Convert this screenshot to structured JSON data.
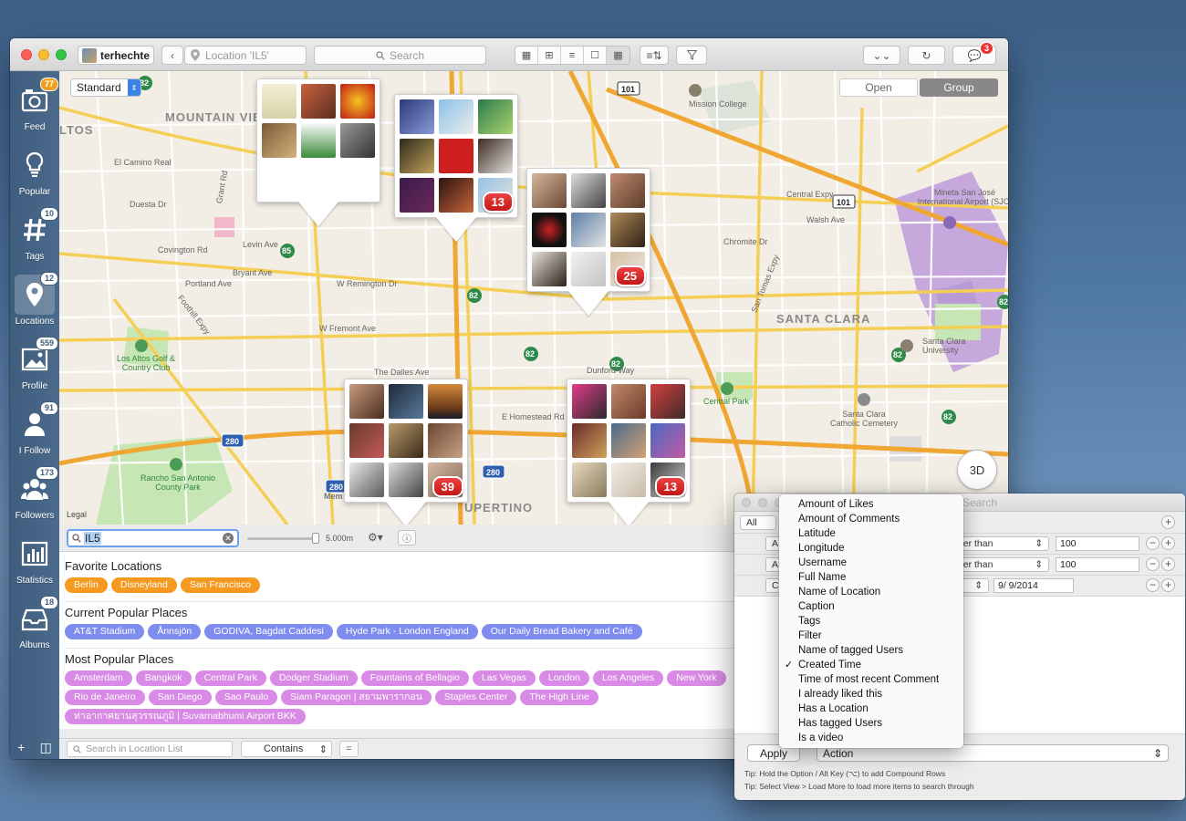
{
  "window": {
    "user": "terhechte",
    "location_field": "Location 'IL5'",
    "search_placeholder": "Search",
    "notification_count": "3"
  },
  "sidebar": {
    "items": [
      {
        "label": "Feed",
        "badge": "77",
        "icon": "camera-icon"
      },
      {
        "label": "Popular",
        "badge": "",
        "icon": "lightbulb-icon"
      },
      {
        "label": "Tags",
        "badge": "10",
        "icon": "hashtag-icon"
      },
      {
        "label": "Locations",
        "badge": "12",
        "icon": "location-pin-icon"
      },
      {
        "label": "Profile",
        "badge": "559",
        "icon": "picture-icon"
      },
      {
        "label": "I Follow",
        "badge": "91",
        "icon": "person-icon"
      },
      {
        "label": "Followers",
        "badge": "173",
        "icon": "people-icon"
      },
      {
        "label": "Statistics",
        "badge": "",
        "icon": "bar-chart-icon"
      },
      {
        "label": "Albums",
        "badge": "18",
        "icon": "inbox-icon"
      }
    ]
  },
  "map": {
    "mode": "Standard",
    "open_label": "Open",
    "group_label": "Group",
    "legal": "Legal",
    "btn_3d": "3D",
    "labels": {
      "mountain_view": "MOUNTAIN VIEW",
      "santa_clara": "SANTA CLARA",
      "cupertino": "UPERTINO",
      "altos": "LTOS",
      "mission_college": "Mission College",
      "airport": "Mineta San José International Airport (SJC)",
      "los_altos_golf": "Los Altos Golf & Country Club",
      "rancho": "Rancho San Antonio County Park",
      "central_park": "Central Park",
      "scu": "Santa Clara University",
      "cemetery": "Santa Clara Catholic Cemetery",
      "central_expy": "Central Expy",
      "foothill": "Foothill Expy",
      "el_camino": "El Camino Real",
      "homestead": "E Homestead Rd",
      "fremont": "W Fremont Ave",
      "dalles": "The Dalles Ave",
      "dunford": "Dunford Way",
      "remington": "W Remington Dr",
      "walsh": "Walsh Ave",
      "covington": "Covington Rd",
      "levin": "Levin Ave",
      "portland": "Portland Ave",
      "bryant": "Bryant Ave",
      "duesta": "Duesta Dr",
      "grant": "Grant Rd",
      "chromite": "Chromite Dr",
      "san_tomas": "San Tomas Expy",
      "m": "Mem"
    },
    "clusters": [
      {
        "count": ""
      },
      {
        "count": "13"
      },
      {
        "count": "25"
      },
      {
        "count": "39"
      },
      {
        "count": "13"
      }
    ]
  },
  "locations": {
    "search_value": "IL5",
    "radius": "5.000m",
    "favorite_title": "Favorite Locations",
    "favorites": [
      "Berlin",
      "Disneyland",
      "San Francisco"
    ],
    "current_title": "Current Popular Places",
    "current": [
      "AT&T Stadium",
      "Ånnsjön",
      "GODIVA, Bagdat Caddesi",
      "Hyde Park - London England",
      "Our Daily Bread Bakery and Café"
    ],
    "most_title": "Most Popular Places",
    "most": [
      "Amsterdam",
      "Bangkok",
      "Central Park",
      "Dodger Stadium",
      "Fountains of Bellagio",
      "Las Vegas",
      "London",
      "Los Angeles",
      "New York",
      "Rio de Janeiro",
      "San Diego",
      "Sao Paulo",
      "Siam Paragon | สยามพารากอน",
      "Staples Center",
      "The High Line",
      "ท่าอากาศยานสุวรรณภูมิ | Suvarnabhumi Airport BKK"
    ],
    "list_search_placeholder": "Search in Location List",
    "match_mode": "Contains",
    "eq_label": "="
  },
  "filter": {
    "title_hint": "Search",
    "all_label": "All",
    "rows": [
      {
        "field": "A",
        "op": "ater than",
        "value": "100"
      },
      {
        "field": "A",
        "op": "ater than",
        "value": "100"
      },
      {
        "field": "C",
        "op": "",
        "value": "9/  9/2014"
      }
    ],
    "apply_label": "Apply",
    "action_label": "Action",
    "tip1": "Tip: Hold the Option / Alt Key (⌥) to add Compound Rows",
    "tip2": "Tip: Select View > Load More to load more items to search through"
  },
  "menu": {
    "items": [
      "Amount of Likes",
      "Amount of Comments",
      "Latitude",
      "Longitude",
      "Username",
      "Full Name",
      "Name of Location",
      "Caption",
      "Tags",
      "Filter",
      "Name of tagged Users",
      "Created Time",
      "Time of most recent Comment",
      "I already liked this",
      "Has a Location",
      "Has tagged Users",
      "Is a video"
    ],
    "checked_index": 11
  },
  "colors": {
    "sidebar": "#44638a",
    "favorite_pill": "#f5991f",
    "current_pill": "#7f8cf0",
    "popular_pill": "#d98ae6",
    "cluster_badge": "#dd2a2a"
  }
}
